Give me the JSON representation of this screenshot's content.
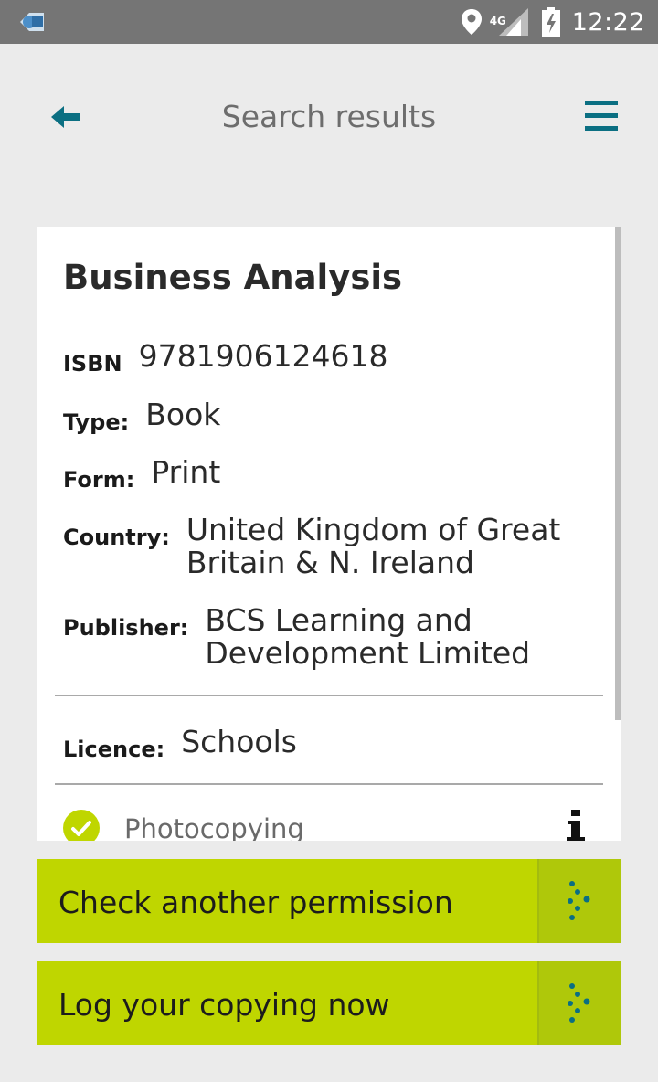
{
  "status_bar": {
    "time": "12:22",
    "network": "4G"
  },
  "header": {
    "title": "Search results",
    "back_icon": "arrow-left-icon",
    "menu_icon": "hamburger-menu-icon"
  },
  "result": {
    "title": "Business Analysis",
    "fields": {
      "isbn_label": "ISBN",
      "isbn": "9781906124618",
      "type_label": "Type:",
      "type": "Book",
      "form_label": "Form:",
      "form": "Print",
      "country_label": "Country:",
      "country_line1": "United Kingdom of Great",
      "country_line2": "Britain & N. Ireland",
      "publisher_label": "Publisher:",
      "publisher_line1": "BCS Learning and",
      "publisher_line2": "Development Limited"
    },
    "licence_label": "Licence:",
    "licence": "Schools",
    "permission": "Photocopying"
  },
  "actions": {
    "check_permission": "Check another permission",
    "log_copying": "Log your copying now"
  },
  "colors": {
    "accent_green": "#bfd600",
    "accent_teal": "#0b6f82",
    "status_bar": "#757575",
    "background": "#ebebeb"
  }
}
